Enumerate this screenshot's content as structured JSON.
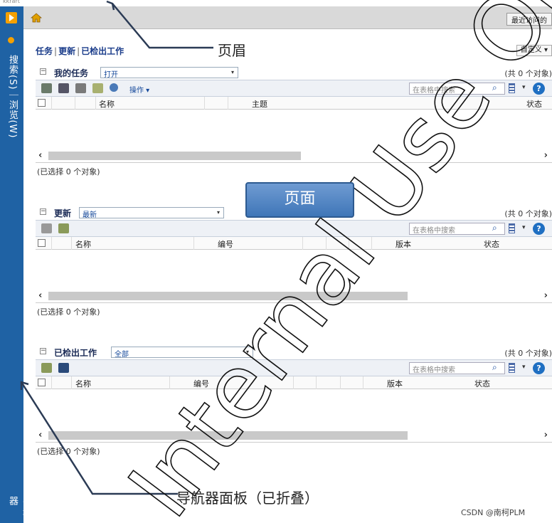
{
  "window": {
    "label": "kkrart"
  },
  "left_nav": {
    "search_browse": "搜索(S)｜浏览(W)",
    "navigator": "导航器"
  },
  "header": {
    "recent": "最近访问的"
  },
  "breadcrumb": {
    "tasks": "任务",
    "updates": "更新",
    "checked_out": "已检出工作"
  },
  "customize": "自定义 ▾",
  "search_placeholder": "在表格中搜索",
  "sections": {
    "tasks": {
      "title": "我的任务",
      "filter": "打开",
      "count": "(共 0 个对象)",
      "operations": "操作 ▾",
      "columns": [
        "名称",
        "主题",
        "状态"
      ],
      "selected": "(已选择 0 个对象)"
    },
    "updates": {
      "title": "更新",
      "filter": "最新",
      "count": "(共 0 个对象)",
      "columns": [
        "名称",
        "编号",
        "版本",
        "状态"
      ],
      "selected": "(已选择 0 个对象)"
    },
    "checked_out": {
      "title": "已检出工作",
      "filter": "全部",
      "count": "(共 0 个对象)",
      "columns": [
        "名称",
        "编号",
        "版本",
        "状态"
      ],
      "selected": "(已选择 0 个对象)"
    }
  },
  "annotations": {
    "header": "页眉",
    "page": "页面",
    "navigator_panel": "导航器面板（已折叠）",
    "watermark": "Internal Use Only"
  },
  "credit": "CSDN @南柯PLM",
  "colors": {
    "nav_blue": "#1f62a4",
    "header_gray": "#d9d9d9",
    "link_blue": "#1a3c8a"
  }
}
